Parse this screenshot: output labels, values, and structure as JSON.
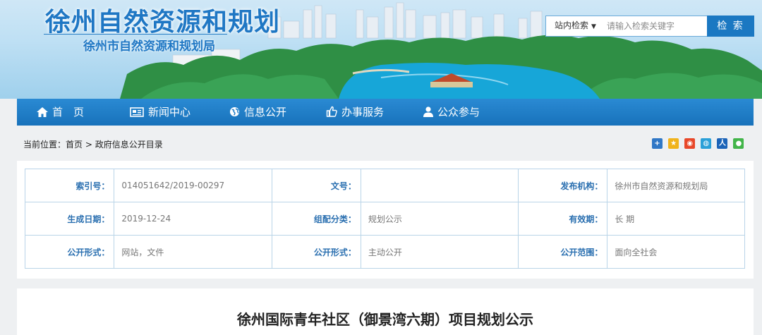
{
  "header": {
    "title": "徐州自然资源和规划",
    "subtitle": "徐州市自然资源和规划局"
  },
  "search": {
    "scope": "站内检索",
    "placeholder": "请输入检索关键字",
    "button": "检 索"
  },
  "nav": {
    "items": [
      {
        "label": "首　页",
        "icon": "home-icon"
      },
      {
        "label": "新闻中心",
        "icon": "newspaper-icon"
      },
      {
        "label": "信息公开",
        "icon": "globe-icon"
      },
      {
        "label": "办事服务",
        "icon": "thumbs-up-icon"
      },
      {
        "label": "公众参与",
        "icon": "user-icon"
      }
    ]
  },
  "breadcrumb": {
    "prefix": "当前位置：",
    "home": "首页",
    "separator": ">",
    "current": "政府信息公开目录"
  },
  "share": {
    "icons": [
      "plus-share-icon",
      "qzone-icon",
      "weibo-icon",
      "tencent-weibo-icon",
      "renren-icon",
      "wechat-icon"
    ]
  },
  "meta": {
    "rows": [
      [
        {
          "key": "索引号：",
          "value": "014051642/2019-00297"
        },
        {
          "key": "文号：",
          "value": ""
        },
        {
          "key": "发布机构：",
          "value": "徐州市自然资源和规划局"
        }
      ],
      [
        {
          "key": "生成日期：",
          "value": "2019-12-24"
        },
        {
          "key": "组配分类：",
          "value": "规划公示"
        },
        {
          "key": "有效期：",
          "value": "长 期"
        }
      ],
      [
        {
          "key": "公开形式：",
          "value": "网站，文件"
        },
        {
          "key": "公开形式：",
          "value": "主动公开"
        },
        {
          "key": "公开范围：",
          "value": "面向全社会"
        }
      ]
    ]
  },
  "article": {
    "title": "徐州国际青年社区（御景湾六期）项目规划公示"
  },
  "colors": {
    "primary": "#1b78c2",
    "nav": "#1f7ec8",
    "label": "#2a6fb0",
    "border": "#b9d4e8"
  }
}
